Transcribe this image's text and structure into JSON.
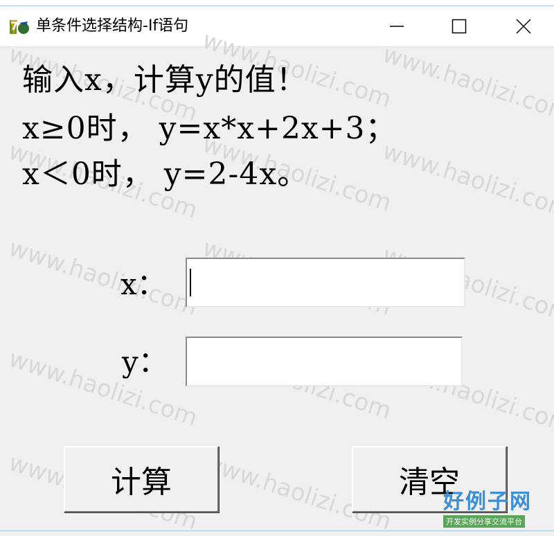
{
  "window": {
    "title": "单条件选择结构-If语句"
  },
  "prompt": {
    "line1": "输入x，计算y的值！",
    "line2": "x≥0时， y=x*x+2x+3；",
    "line3": "x＜0时， y=2-4x。"
  },
  "form": {
    "x_label": "x：",
    "x_value": "",
    "y_label": "y：",
    "y_value": ""
  },
  "buttons": {
    "calculate": "计算",
    "clear": "清空"
  },
  "watermark": {
    "text": "www.haolizi.com",
    "logo_main": "好例子网",
    "logo_sub": "开发实例分享交流平台"
  },
  "colors": {
    "window_bg": "#f0f0f0",
    "titlebar_bg": "#ffffff",
    "logo_blue": "#3b8fd6",
    "logo_green": "#5aa55a"
  }
}
